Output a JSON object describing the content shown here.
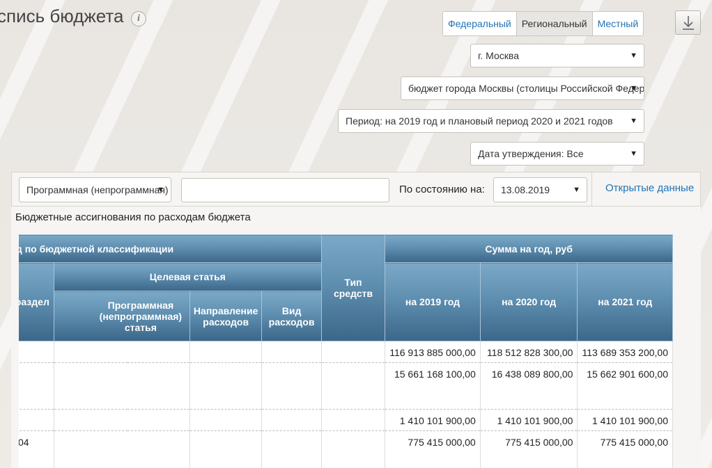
{
  "page": {
    "title": "спись бюджета",
    "info_icon": "info-icon"
  },
  "levels": [
    {
      "label": "Федеральный",
      "active": false
    },
    {
      "label": "Региональный",
      "active": true
    },
    {
      "label": "Местный",
      "active": false
    }
  ],
  "download_icon": "download-icon",
  "filters": {
    "region": "г. Москва",
    "budget": "бюджет города Москвы (столицы Российской Федерации)",
    "period": "Период: на 2019 год и плановый период 2020 и 2021 годов",
    "approval_date": "Дата утверждения: Все"
  },
  "toolbar": {
    "classification_select": "Программная (непрограммная)",
    "search_value": "",
    "state_label": "По состоянию на:",
    "state_date": "13.08.2019",
    "open_data_link": "Открытые данные"
  },
  "section_title": "Бюджетные ассигнования по расходам бюджета",
  "table": {
    "headers": {
      "code_group": "Код по бюджетной классификации",
      "subsection": "Подраздел",
      "target_article": "Целевая статья",
      "program_article": "Программная (непрограммная) статья",
      "direction": "Направление расходов",
      "expense_type": "Вид расходов",
      "fund_type": "Тип средств",
      "sum_group": "Сумма на год, руб",
      "y2019": "на 2019 год",
      "y2020": "на 2020 год",
      "y2021": "на 2021 год"
    },
    "rows": [
      {
        "subsection": "",
        "y2019": "116 913 885 000,00",
        "y2020": "118 512 828 300,00",
        "y2021": "113 689 353 200,00"
      },
      {
        "subsection": "",
        "y2019": "15 661 168 100,00",
        "y2020": "16 438 089 800,00",
        "y2021": "15 662 901 600,00"
      },
      {
        "subsection": "",
        "y2019": "1 410 101 900,00",
        "y2020": "1 410 101 900,00",
        "y2021": "1 410 101 900,00"
      },
      {
        "subsection": "04",
        "y2019": "775 415 000,00",
        "y2020": "775 415 000,00",
        "y2021": "775 415 000,00"
      }
    ]
  }
}
